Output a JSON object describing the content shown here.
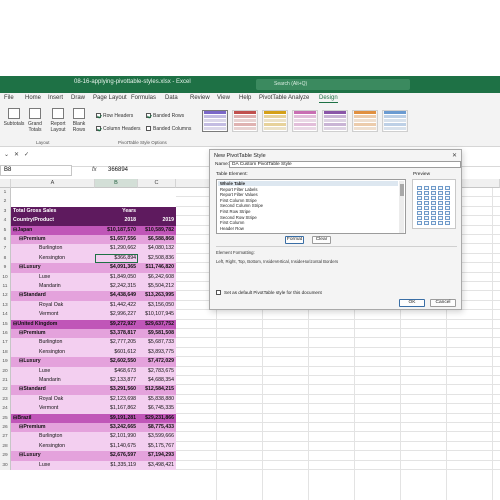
{
  "window": {
    "title": "08-16-applying-pivottable-styles.xlsx  -  Excel",
    "search_placeholder": "Search (Alt+Q)"
  },
  "menu": {
    "tabs": [
      "File",
      "Home",
      "Insert",
      "Draw",
      "Page Layout",
      "Formulas",
      "Data",
      "Review",
      "View",
      "Help",
      "PivotTable Analyze",
      "Design"
    ],
    "active": "Design"
  },
  "ribbon": {
    "subtotals": "Subtotals",
    "grand_totals": "Grand Totals",
    "report_layout": "Report Layout",
    "blank_rows": "Blank Rows",
    "layout_group": "Layout",
    "row_headers": "Row Headers",
    "column_headers": "Column Headers",
    "banded_rows": "Banded Rows",
    "banded_columns": "Banded Columns",
    "options_group": "PivotTable Style Options",
    "style_colors": [
      "#7b68c8",
      "#c0504d",
      "#d4a017",
      "#c86fb3",
      "#8a56a8",
      "#e09040",
      "#6b9bd1"
    ]
  },
  "formula_bar": {
    "name_box": "B8",
    "fx": "fx",
    "value": "366894"
  },
  "columns": [
    "A",
    "B",
    "C"
  ],
  "sheet": {
    "colors": {
      "header_dark": "#5e1a5e",
      "level1": "#c056b8",
      "level2": "#e4a2dc",
      "level3": "#f3cff0",
      "text_dark": "#111111"
    },
    "rows": [
      {
        "n": "1",
        "a": "",
        "b": "",
        "c": "",
        "style": "blank"
      },
      {
        "n": "2",
        "a": "",
        "b": "",
        "c": "",
        "style": "blank"
      },
      {
        "n": "3",
        "a": "Total Gross Sales",
        "b": "Years",
        "c": "",
        "style": "hdr"
      },
      {
        "n": "4",
        "a": "Country/Product",
        "b": "2018",
        "c": "2019",
        "style": "hdr"
      },
      {
        "n": "5",
        "a": "⊟Japan",
        "b": "$10,187,570",
        "c": "$10,589,782",
        "style": "l1"
      },
      {
        "n": "6",
        "a": "⊟Premium",
        "b": "$1,657,556",
        "c": "$6,588,868",
        "style": "l2"
      },
      {
        "n": "7",
        "a": "Burlington",
        "b": "$1,290,662",
        "c": "$4,080,132",
        "style": "l3"
      },
      {
        "n": "8",
        "a": "Kensington",
        "b": "$366,894",
        "c": "$2,508,836",
        "style": "l3"
      },
      {
        "n": "9",
        "a": "⊟Luxury",
        "b": "$4,091,365",
        "c": "$11,746,820",
        "style": "l2"
      },
      {
        "n": "10",
        "a": "Luxe",
        "b": "$1,849,050",
        "c": "$6,242,608",
        "style": "l3"
      },
      {
        "n": "11",
        "a": "Mandarin",
        "b": "$2,242,315",
        "c": "$5,504,212",
        "style": "l3"
      },
      {
        "n": "12",
        "a": "⊟Standard",
        "b": "$4,438,649",
        "c": "$13,263,995",
        "style": "l2"
      },
      {
        "n": "13",
        "a": "Royal Oak",
        "b": "$1,442,422",
        "c": "$3,156,050",
        "style": "l3"
      },
      {
        "n": "14",
        "a": "Vermont",
        "b": "$2,996,227",
        "c": "$10,107,945",
        "style": "l3"
      },
      {
        "n": "15",
        "a": "⊟United Kingdom",
        "b": "$9,272,927",
        "c": "$29,637,752",
        "style": "l1"
      },
      {
        "n": "16",
        "a": "⊟Premium",
        "b": "$3,378,817",
        "c": "$9,581,508",
        "style": "l2"
      },
      {
        "n": "17",
        "a": "Burlington",
        "b": "$2,777,205",
        "c": "$5,687,733",
        "style": "l3"
      },
      {
        "n": "18",
        "a": "Kensington",
        "b": "$601,612",
        "c": "$3,893,775",
        "style": "l3"
      },
      {
        "n": "19",
        "a": "⊟Luxury",
        "b": "$2,602,550",
        "c": "$7,472,029",
        "style": "l2"
      },
      {
        "n": "20",
        "a": "Luxe",
        "b": "$468,673",
        "c": "$2,783,675",
        "style": "l3"
      },
      {
        "n": "21",
        "a": "Mandarin",
        "b": "$2,133,877",
        "c": "$4,688,354",
        "style": "l3"
      },
      {
        "n": "22",
        "a": "⊟Standard",
        "b": "$3,291,560",
        "c": "$12,584,215",
        "style": "l2"
      },
      {
        "n": "23",
        "a": "Royal Oak",
        "b": "$2,123,698",
        "c": "$5,838,880",
        "style": "l3"
      },
      {
        "n": "24",
        "a": "Vermont",
        "b": "$1,167,862",
        "c": "$6,745,335",
        "style": "l3"
      },
      {
        "n": "25",
        "a": "⊟Brazil",
        "b": "$9,191,281",
        "c": "$29,231,866",
        "style": "l1"
      },
      {
        "n": "26",
        "a": "⊟Premium",
        "b": "$3,242,665",
        "c": "$8,775,433",
        "style": "l2"
      },
      {
        "n": "27",
        "a": "Burlington",
        "b": "$2,101,990",
        "c": "$3,599,666",
        "style": "l3"
      },
      {
        "n": "28",
        "a": "Kensington",
        "b": "$1,140,675",
        "c": "$5,175,767",
        "style": "l3"
      },
      {
        "n": "29",
        "a": "⊟Luxury",
        "b": "$2,676,597",
        "c": "$7,194,293",
        "style": "l2"
      },
      {
        "n": "30",
        "a": "Luxe",
        "b": "$1,335,119",
        "c": "$3,498,421",
        "style": "l3"
      }
    ]
  },
  "dialog": {
    "title": "New PivotTable Style",
    "close": "✕",
    "name_label": "Name:",
    "name_value": "DA Custom PivotTable Style",
    "table_element_label": "Table Element:",
    "elements": [
      "Whole Table",
      "Report Filter Labels",
      "Report Filter Values",
      "First Column Stripe",
      "Second Column Stripe",
      "First Row Stripe",
      "Second Row Stripe",
      "First Column",
      "Header Row"
    ],
    "selected_element": "Whole Table",
    "preview_label": "Preview",
    "format_button": "Format",
    "clear_button": "Clear",
    "element_formatting_label": "Element Formatting:",
    "element_formatting_value": "Left, Right, Top, Bottom, InsideVertical, InsideHorizontal Borders",
    "default_checkbox": "Set as default PivotTable style for this document",
    "ok_button": "OK",
    "cancel_button": "Cancel"
  }
}
